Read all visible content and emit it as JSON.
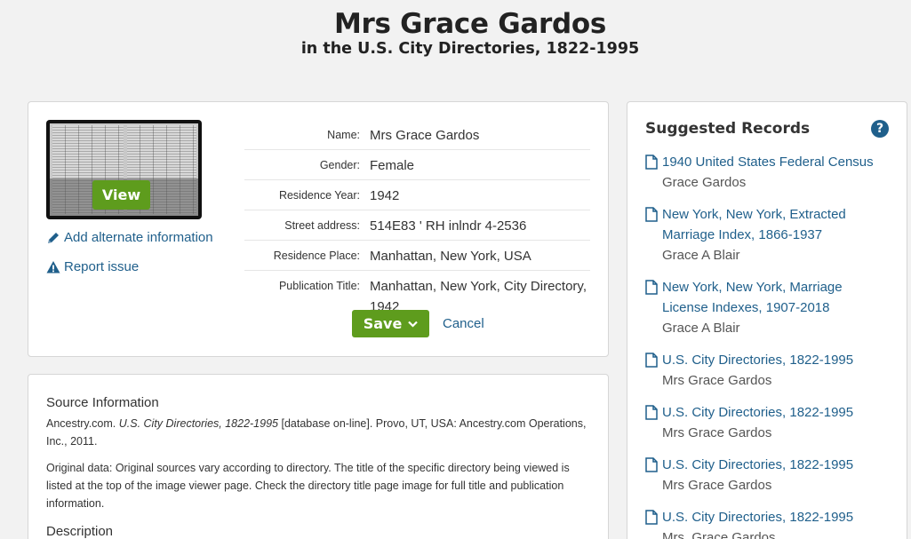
{
  "header": {
    "title": "Mrs Grace Gardos",
    "subtitle": "in the U.S. City Directories, 1822-1995"
  },
  "image_viewer": {
    "view_label": "View"
  },
  "sidebar_links": {
    "add_alternate": "Add alternate information",
    "report_issue": "Report issue"
  },
  "record": {
    "fields": [
      {
        "label": "Name:",
        "value": "Mrs Grace Gardos"
      },
      {
        "label": "Gender:",
        "value": "Female"
      },
      {
        "label": "Residence Year:",
        "value": "1942"
      },
      {
        "label": "Street address:",
        "value": "514E83 ' RH inlndr 4-2536"
      },
      {
        "label": "Residence Place:",
        "value": "Manhattan, New York, USA"
      },
      {
        "label": "Publication Title:",
        "value": "Manhattan, New York, City Directory, 1942"
      }
    ]
  },
  "actions": {
    "save_label": "Save",
    "cancel_label": "Cancel"
  },
  "source": {
    "title": "Source Information",
    "citation_prefix": "Ancestry.com.",
    "citation_italic": "U.S. City Directories, 1822-1995",
    "citation_suffix": "[database on-line]. Provo, UT, USA: Ancestry.com Operations, Inc., 2011.",
    "original_data": "Original data: Original sources vary according to directory. The title of the specific directory being viewed is listed at the top of the image viewer page. Check the directory title page image for full title and publication information.",
    "description_title": "Description"
  },
  "suggested": {
    "title": "Suggested Records",
    "help_icon": "question-circle-icon",
    "items": [
      {
        "title": "1940 United States Federal Census",
        "name": "Grace Gardos"
      },
      {
        "title": "New York, New York, Extracted Marriage Index, 1866-1937",
        "name": "Grace A Blair"
      },
      {
        "title": "New York, New York, Marriage License Indexes, 1907-2018",
        "name": "Grace A Blair"
      },
      {
        "title": "U.S. City Directories, 1822-1995",
        "name": "Mrs Grace Gardos"
      },
      {
        "title": "U.S. City Directories, 1822-1995",
        "name": "Mrs Grace Gardos"
      },
      {
        "title": "U.S. City Directories, 1822-1995",
        "name": "Mrs Grace Gardos"
      },
      {
        "title": "U.S. City Directories, 1822-1995",
        "name": "Mrs. Grace Gardos"
      }
    ]
  },
  "colors": {
    "link": "#1f5f8b",
    "button_green": "#5e9c1d",
    "background": "#f2f2f2"
  }
}
